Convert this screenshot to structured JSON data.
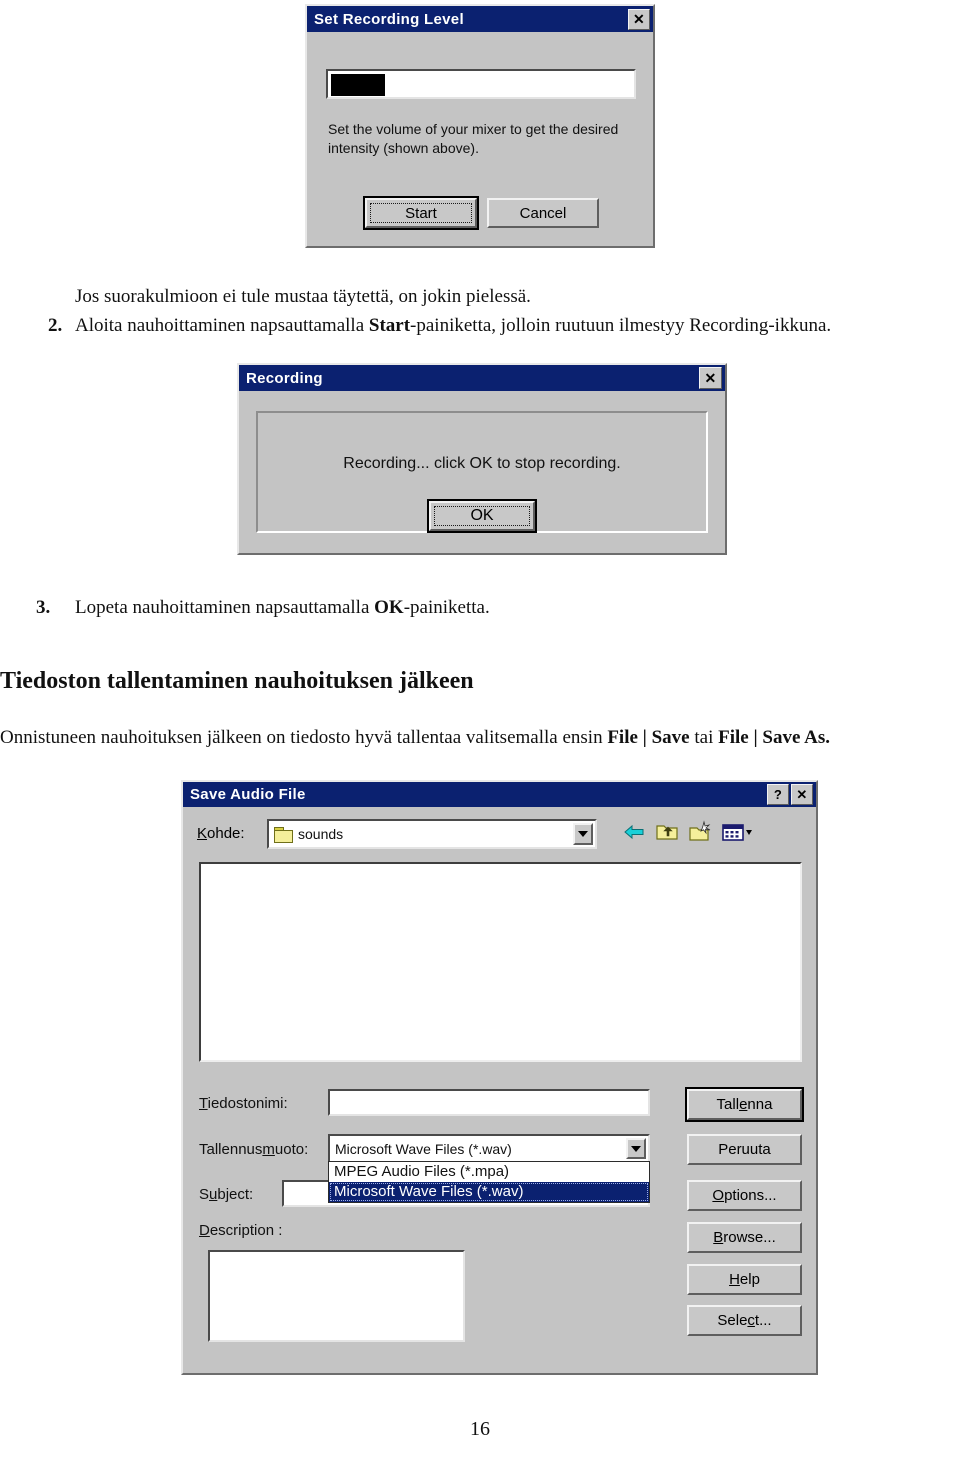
{
  "document": {
    "page_number": "16",
    "paragraphs": [
      {
        "id": "p1",
        "text": "Jos suorakulmioon ei tule mustaa täytettä, on jokin pielessä."
      },
      {
        "id": "step2_num",
        "text": "2."
      },
      {
        "id": "step2_a",
        "text": "Aloita nauhoittaminen napsauttamalla "
      },
      {
        "id": "step2_b",
        "text": "Start"
      },
      {
        "id": "step2_c",
        "text": "-painiketta, jolloin ruutuun ilmestyy Recording-ikkuna."
      },
      {
        "id": "step3_num",
        "text": "3."
      },
      {
        "id": "step3_a",
        "text": "Lopeta nauhoittaminen napsauttamalla "
      },
      {
        "id": "step3_b",
        "text": "OK"
      },
      {
        "id": "step3_c",
        "text": "-painiketta."
      },
      {
        "id": "heading",
        "text": "Tiedoston tallentaminen nauhoituksen jälkeen"
      },
      {
        "id": "p4_a",
        "text": "Onnistuneen nauhoituksen jälkeen on tiedosto hyvä tallentaa valitsemalla ensin "
      },
      {
        "id": "p4_b",
        "text": "File | Save"
      },
      {
        "id": "p4_c",
        "text": " tai "
      },
      {
        "id": "p4_d",
        "text": "File | Save As."
      }
    ]
  },
  "set_recording_level": {
    "title": "Set Recording Level",
    "close_label": "✕",
    "close_icon": "close-icon",
    "meter_level_percent": 18,
    "help_text": "Set the volume of your mixer to get the desired intensity (shown above).",
    "start_label": "Start",
    "start_accesskey": "t",
    "cancel_label": "Cancel"
  },
  "recording": {
    "title": "Recording",
    "close_label": "✕",
    "close_icon": "close-icon",
    "message": "Recording... click OK to stop recording.",
    "ok_label": "OK"
  },
  "save_audio_file": {
    "title": "Save Audio File",
    "help_label": "?",
    "close_label": "✕",
    "help_icon": "question-mark-icon",
    "close_icon": "close-icon",
    "lookin_label": "Kohde:",
    "lookin_value": "sounds",
    "lookin_icon": "folder-icon",
    "toolbar": [
      {
        "name": "back-icon",
        "title": "Back"
      },
      {
        "name": "up-one-level-icon",
        "title": "Up One Level"
      },
      {
        "name": "new-folder-icon",
        "title": "Create New Folder"
      },
      {
        "name": "views-icon",
        "title": "Views"
      }
    ],
    "file_list_items": [],
    "filename_label": "Tiedostonimi:",
    "filename_value": "",
    "format_label": "Tallennusmuoto:",
    "format_value": "Microsoft Wave Files (*.wav)",
    "format_options": [
      {
        "label": "MPEG Audio Files (*.mpa)",
        "selected": false
      },
      {
        "label": "Microsoft Wave Files (*.wav)",
        "selected": true
      }
    ],
    "subject_label": "Subject:",
    "subject_value": "",
    "description_label": "Description :",
    "description_value": "",
    "buttons": [
      {
        "name": "save-button",
        "label": "Tallenna",
        "default": true
      },
      {
        "name": "cancel-button",
        "label": "Peruuta",
        "default": false
      },
      {
        "name": "options-button",
        "label": "Options...",
        "default": false
      },
      {
        "name": "browse-button",
        "label": "Browse...",
        "default": false
      },
      {
        "name": "help-button",
        "label": "Help",
        "default": false
      },
      {
        "name": "select-button",
        "label": "Select...",
        "default": false
      }
    ]
  },
  "colors": {
    "titlebar": "#0b2170",
    "dialog_face": "#c4c4c4",
    "selection": "#0b2170",
    "meter_fill": "#000000"
  }
}
